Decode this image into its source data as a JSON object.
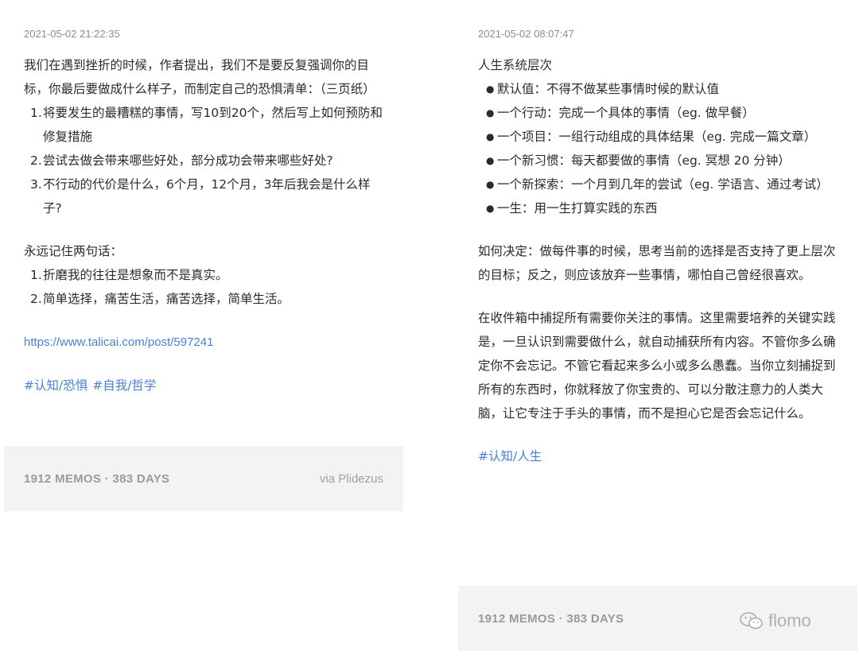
{
  "left": {
    "timestamp": "2021-05-02 21:22:35",
    "intro": "我们在遇到挫折的时候，作者提出，我们不是要反复强调你的目标，你最后要做成什么样子，而制定自己的恐惧清单：（三页纸）",
    "list1": [
      {
        "num": "1.",
        "text": "将要发生的最糟糕的事情，写10到20个，然后写上如何预防和修复措施"
      },
      {
        "num": "2.",
        "text": "尝试去做会带来哪些好处，部分成功会带来哪些好处?"
      },
      {
        "num": "3.",
        "text": "不行动的代价是什么，6个月，12个月，3年后我会是什么样子?"
      }
    ],
    "remember": "永远记住两句话：",
    "list2": [
      {
        "num": "1.",
        "text": "折磨我的往往是想象而不是真实。"
      },
      {
        "num": "2.",
        "text": "简单选择，痛苦生活，痛苦选择，简单生活。"
      }
    ],
    "link": "https://www.talicai.com/post/597241",
    "tags": [
      "#认知/恐惧",
      "#自我/哲学"
    ],
    "footer": {
      "stats": "1912 MEMOS · 383 DAYS",
      "via": "via Plidezus"
    }
  },
  "right": {
    "timestamp": "2021-05-02 08:07:47",
    "heading": "人生系统层次",
    "bullets": [
      "默认值：不得不做某些事情时候的默认值",
      "一个行动：完成一个具体的事情（eg. 做早餐）",
      "一个项目：一组行动组成的具体结果（eg. 完成一篇文章）",
      "一个新习惯：每天都要做的事情（eg. 冥想 20 分钟）",
      "一个新探索：一个月到几年的尝试（eg. 学语言、通过考试）",
      "一生：用一生打算实践的东西"
    ],
    "para1": "如何决定：做每件事的时候，思考当前的选择是否支持了更上层次的目标；反之，则应该放弃一些事情，哪怕自己曾经很喜欢。",
    "para2": "在收件箱中捕捉所有需要你关注的事情。这里需要培养的关键实践是，一旦认识到需要做什么，就自动捕获所有内容。不管你多么确定你不会忘记。不管它看起来多么小或多么愚蠢。当你立刻捕捉到所有的东西时，你就释放了你宝贵的、可以分散注意力的人类大脑，让它专注于手头的事情，而不是担心它是否会忘记什么。",
    "tags": [
      "#认知/人生"
    ],
    "footer": {
      "stats": "1912 MEMOS · 383 DAYS"
    }
  },
  "watermark": {
    "text": "flomo",
    "icon": "wechat-icon"
  }
}
